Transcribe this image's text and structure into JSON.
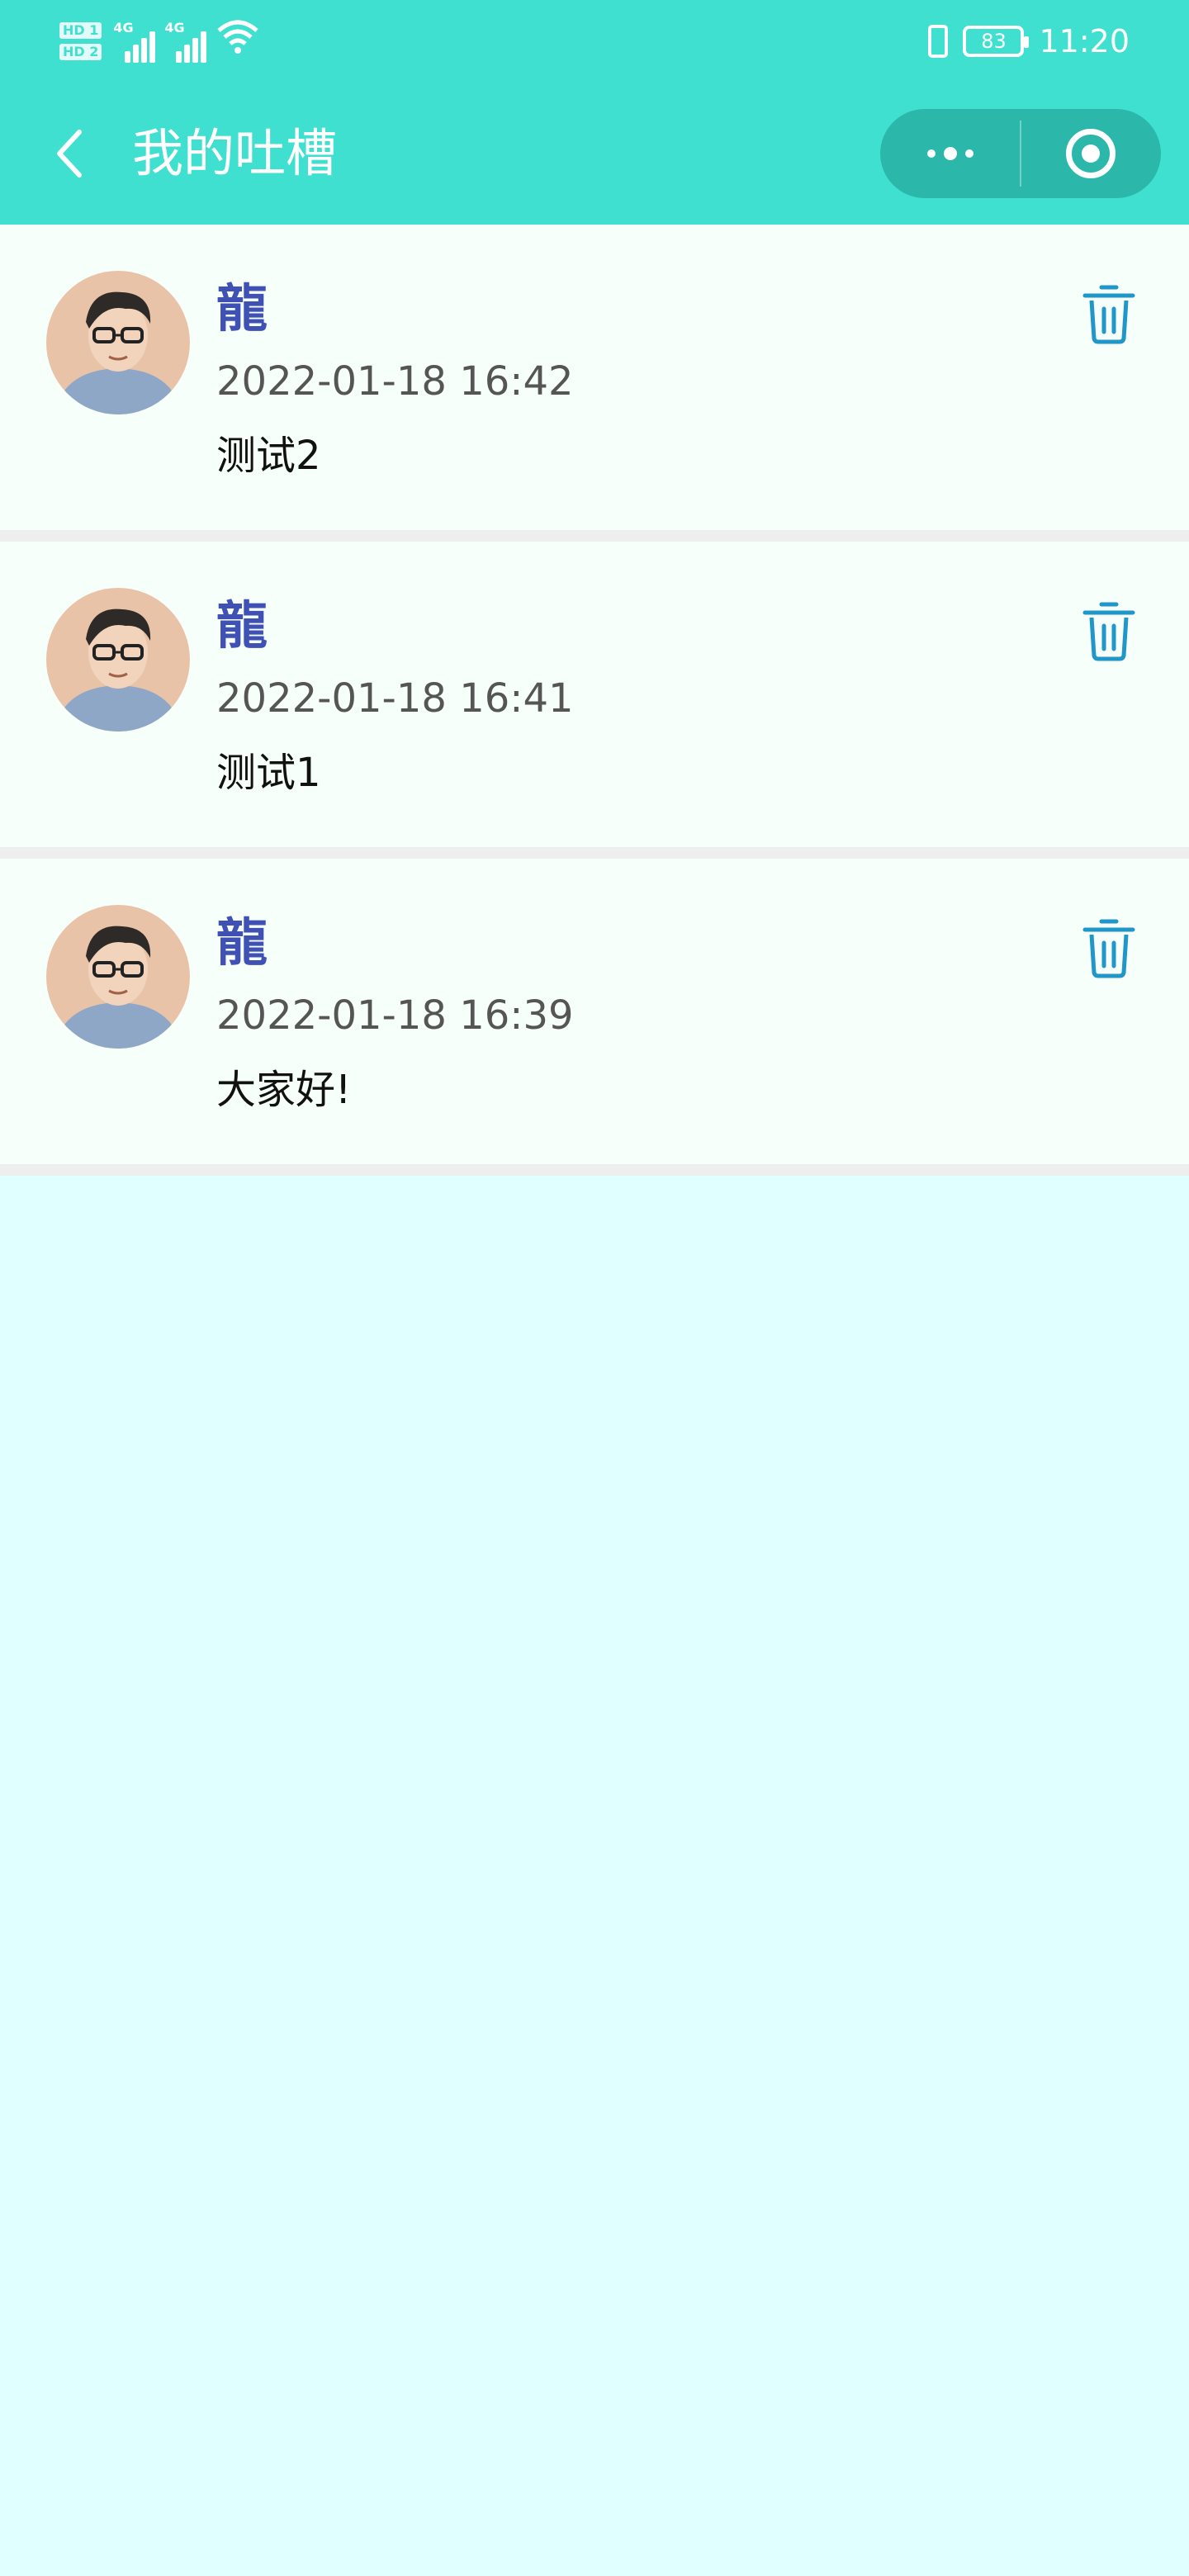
{
  "status_bar": {
    "hd1": "HD 1",
    "hd2": "HD 2",
    "network1": "4G",
    "network2": "4G",
    "battery": "83",
    "time": "11:20"
  },
  "nav": {
    "title": "我的吐槽"
  },
  "posts": [
    {
      "name": "龍",
      "time": "2022-01-18 16:42",
      "content": "测试2"
    },
    {
      "name": "龍",
      "time": "2022-01-18 16:41",
      "content": "测试1"
    },
    {
      "name": "龍",
      "time": "2022-01-18 16:39",
      "content": "大家好!"
    }
  ],
  "colors": {
    "header": "#40e0d0",
    "page_background": "#e0ffff",
    "username": "#3f51b5",
    "trash_icon": "#2196c9"
  }
}
